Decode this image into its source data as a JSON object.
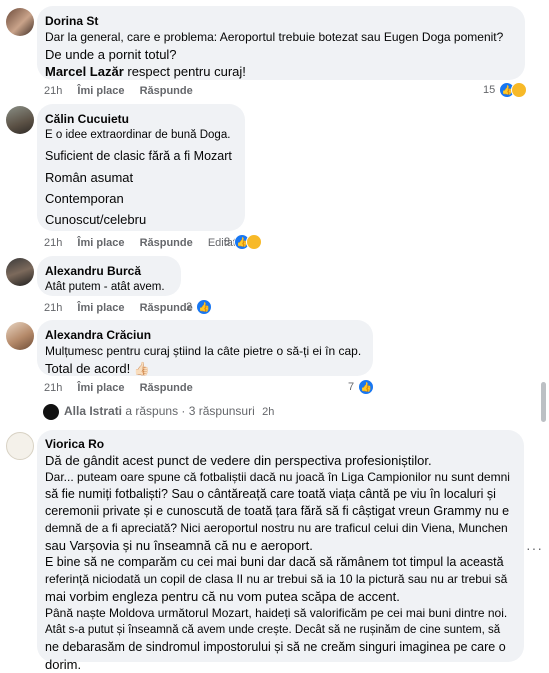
{
  "comments": [
    {
      "author": "Dorina St",
      "lines": [
        "Dar la general, care e problema: Aeroportul trebuie botezat sau Eugen Doga pomenit?",
        "De unde a pornit totul?"
      ],
      "mention": "Marcel Lazăr",
      "mention_rest": " respect pentru curaj!",
      "time": "21h",
      "like": "Îmi place",
      "reply": "Răspunde",
      "reactions": "15"
    },
    {
      "author": "Călin Cucuietu",
      "paragraphs": [
        "E o idee extraordinar de bună Doga.",
        "Suficient de clasic fără a fi Mozart",
        "Român asumat",
        "Contemporan",
        "Cunoscut/celebru"
      ],
      "time": "21h",
      "like": "Îmi place",
      "reply": "Răspunde",
      "edited": "Editat",
      "reactions": "8"
    },
    {
      "author": "Alexandru Burcă",
      "lines": [
        "Atât putem - atât avem."
      ],
      "time": "21h",
      "like": "Îmi place",
      "reply": "Răspunde",
      "reactions": "2"
    },
    {
      "author": "Alexandra Crăciun",
      "lines": [
        "Mulțumesc pentru curaj știind la câte pietre o să-ți ei în cap.",
        "Total de acord! 👍🏻"
      ],
      "time": "21h",
      "like": "Îmi place",
      "reply": "Răspunde",
      "reactions": "7"
    },
    {
      "author": "Viorica Ro",
      "lines": [
        "Dă de gândit acest punct de vedere din perspectiva profesioniștilor.",
        "Dar... puteam oare spune că fotbaliștii dacă nu joacă în Liga Campionilor nu sunt demni",
        "să fie numiți fotbaliști? Sau o cântăreață care toată viața cântă pe viu în localuri și",
        "ceremonii private și e cunoscută de toată țara fără să fi câștigat vreun Grammy nu e",
        "demnă de a fi apreciată? Nici aeroportul nostru nu are traficul celui din Viena, Munchen",
        "sau Varșovia și nu înseamnă că nu e aeroport.",
        "E bine să ne comparăm cu cei mai buni dar dacă să rămânem tot timpul la această",
        "referință niciodată un copil de clasa II nu ar trebui să ia 10 la pictură sau nu ar trebui să",
        "mai vorbim engleza pentru că nu vom putea scăpa de accent.",
        "Până naște Moldova următorul Mozart, haideți să valorificăm pe cei mai buni dintre noi.",
        "Atât s-a putut și înseamnă că avem unde crește. Decât să ne rușinăm de cine suntem, să",
        "ne debarasăm de sindromul impostorului și să ne creăm singuri imaginea pe care o",
        "dorim."
      ]
    }
  ],
  "reply_thread": {
    "name": "Alla Istrati",
    "text": " a răspuns · 3 răspunsuri",
    "time": "2h"
  },
  "colors": {
    "like": "#1877f2",
    "haha": "#f7b928",
    "bubble": "#f0f2f5",
    "meta": "#65676b"
  },
  "icons": [
    "like-reaction-icon",
    "haha-reaction-icon",
    "more-options-icon"
  ]
}
